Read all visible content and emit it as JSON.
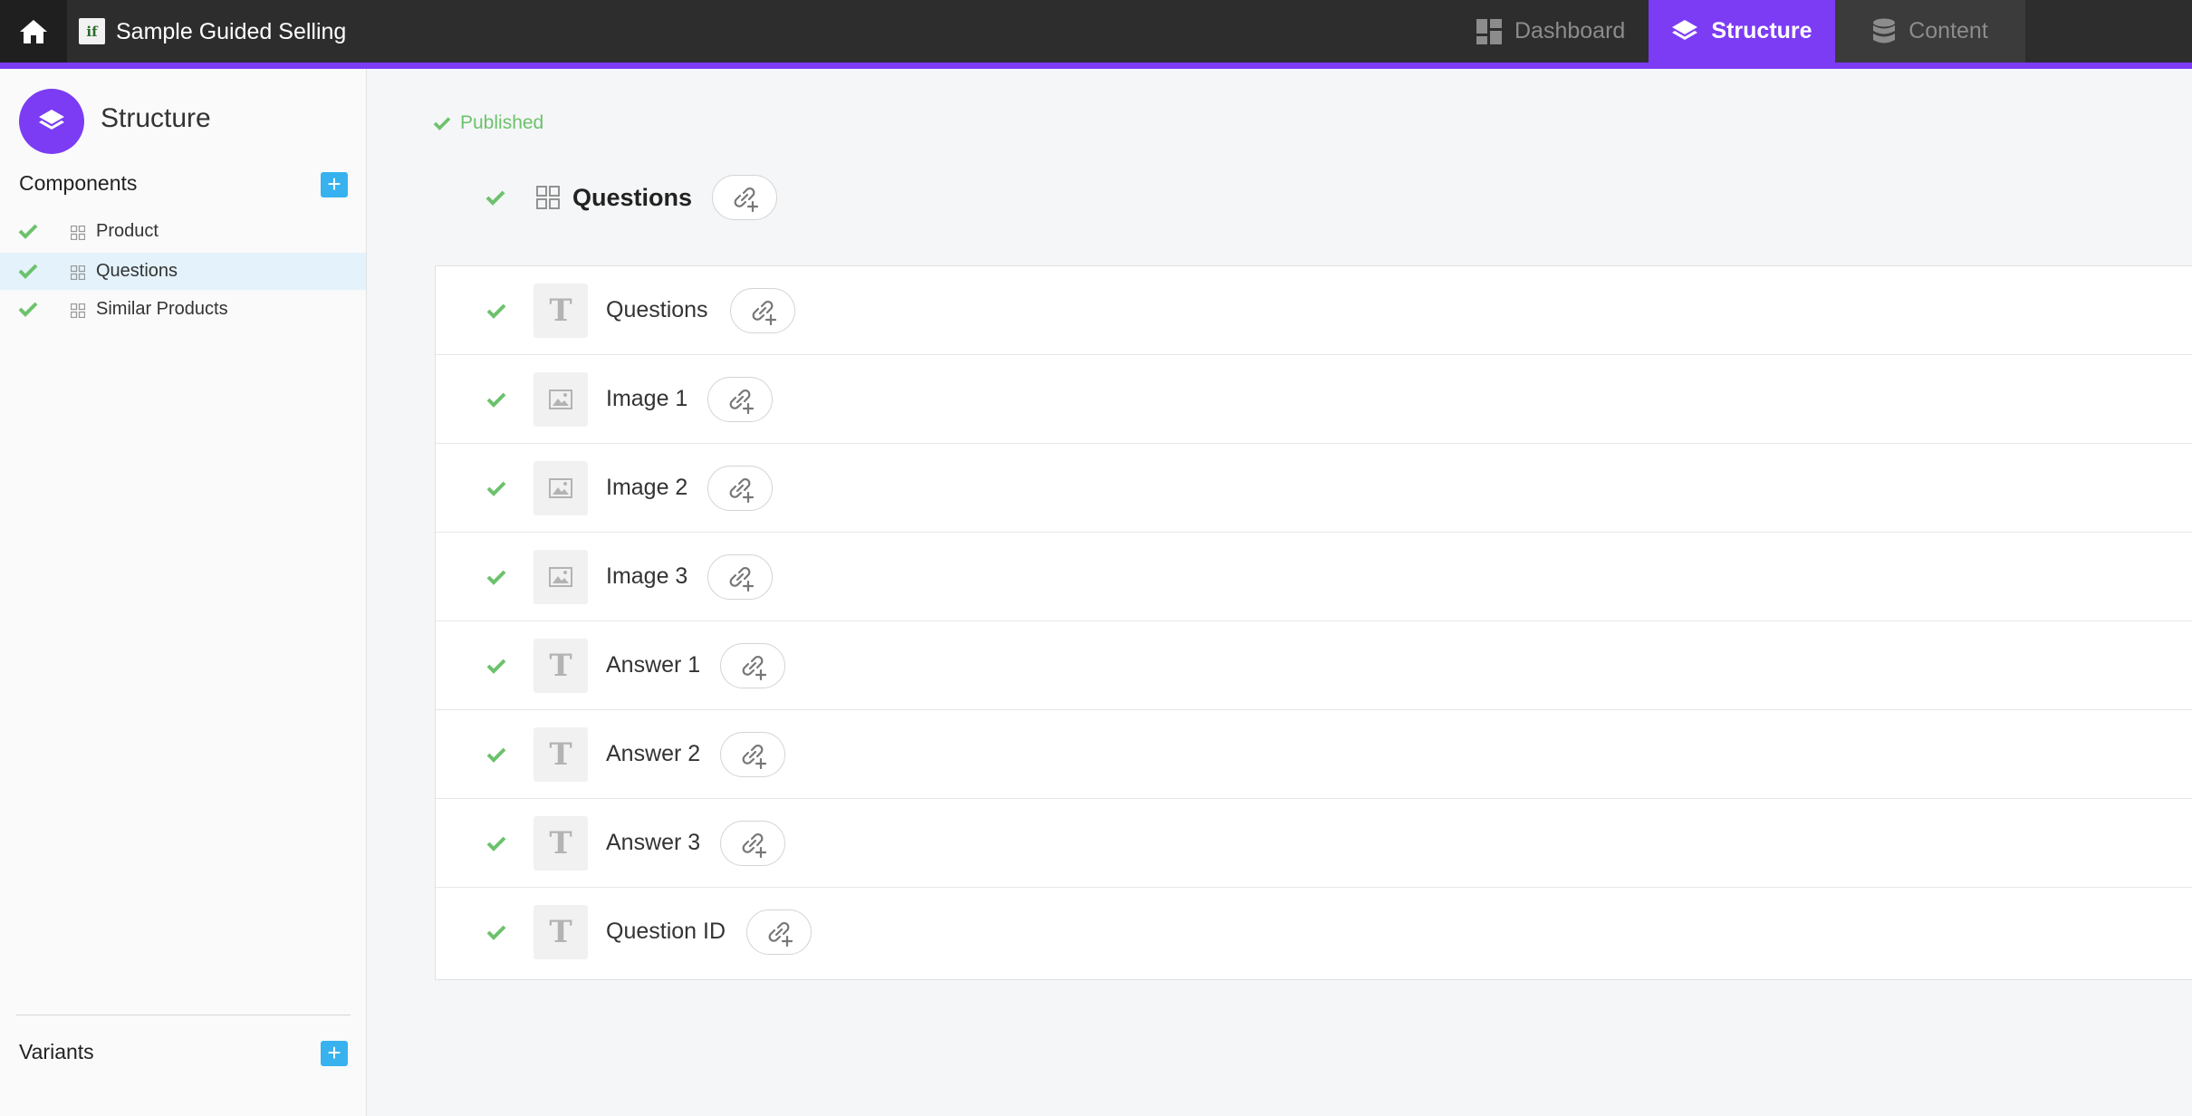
{
  "app": {
    "title": "Sample Guided Selling",
    "logo_text": "if"
  },
  "nav": {
    "tabs": [
      {
        "label": "Dashboard",
        "icon": "dashboard-icon",
        "active": false
      },
      {
        "label": "Structure",
        "icon": "layers-icon",
        "active": true
      },
      {
        "label": "Content",
        "icon": "database-icon",
        "active": false
      }
    ]
  },
  "colors": {
    "accent": "#7b3cf4",
    "topbar": "#2d2d2e",
    "success": "#6cc26c",
    "add_button": "#38b2ee",
    "selected_row": "#e3f2fb"
  },
  "sidebar": {
    "title": "Structure",
    "components_label": "Components",
    "components": [
      {
        "label": "Product",
        "status": "published",
        "selected": false
      },
      {
        "label": "Questions",
        "status": "published",
        "selected": true
      },
      {
        "label": "Similar Products",
        "status": "published",
        "selected": false
      }
    ],
    "variants_label": "Variants",
    "add_label": "+"
  },
  "main": {
    "status": "Published",
    "component_title": "Questions",
    "fields": [
      {
        "name": "Questions",
        "type": "text",
        "type_glyph": "T"
      },
      {
        "name": "Image 1",
        "type": "image",
        "type_glyph": ""
      },
      {
        "name": "Image 2",
        "type": "image",
        "type_glyph": ""
      },
      {
        "name": "Image 3",
        "type": "image",
        "type_glyph": ""
      },
      {
        "name": "Answer 1",
        "type": "text",
        "type_glyph": "T"
      },
      {
        "name": "Answer 2",
        "type": "text",
        "type_glyph": "T"
      },
      {
        "name": "Answer 3",
        "type": "text",
        "type_glyph": "T"
      },
      {
        "name": "Question ID",
        "type": "text",
        "type_glyph": "T"
      }
    ]
  }
}
